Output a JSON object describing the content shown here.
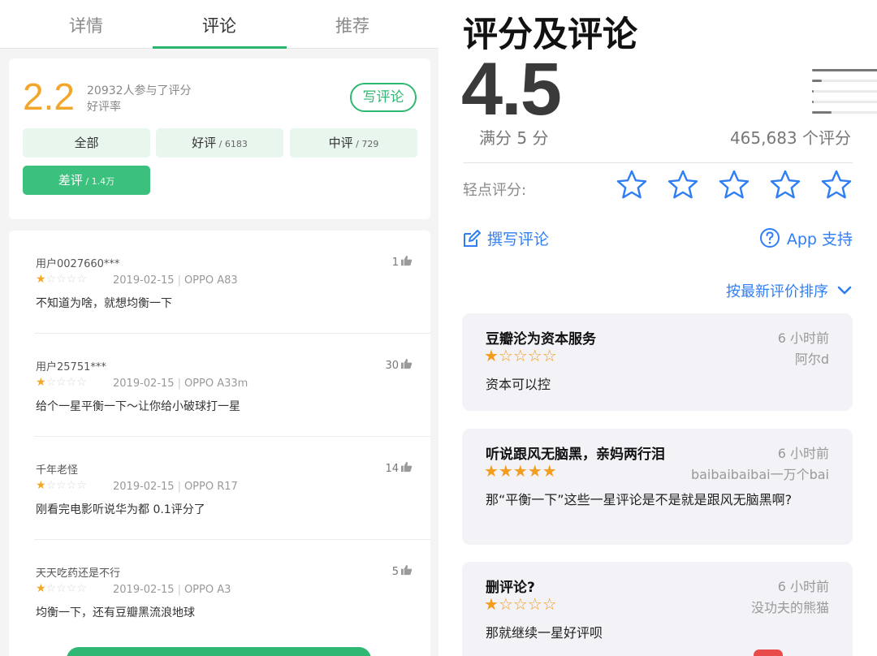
{
  "left": {
    "tabs": [
      "详情",
      "评论",
      "推荐"
    ],
    "summary": {
      "score": "2.2",
      "participants": "20932人参与了评分",
      "good_rate": "好评率",
      "write_button": "写评论",
      "filters": [
        {
          "label": "全部",
          "count": ""
        },
        {
          "label": "好评",
          "count": " / 6183"
        },
        {
          "label": "中评",
          "count": " / 729"
        },
        {
          "label": "差评",
          "count": " / 1.4万"
        }
      ]
    },
    "reviews": [
      {
        "user": "用户0027660***",
        "date": "2019-02-15",
        "device": "OPPO A83",
        "text": "不知道为啥，就想均衡一下",
        "likes": "1",
        "stars": 1
      },
      {
        "user": "用户25751***",
        "date": "2019-02-15",
        "device": "OPPO A33m",
        "text": "给个一星平衡一下～让你给小破球打一星",
        "likes": "30",
        "stars": 1
      },
      {
        "user": "千年老怪",
        "date": "2019-02-15",
        "device": "OPPO R17",
        "text": "刚看完电影听说华为都 0.1评分了",
        "likes": "14",
        "stars": 1
      },
      {
        "user": "天天吃药还是不行",
        "date": "2019-02-15",
        "device": "OPPO A3",
        "text": "均衡一下，还有豆瓣黑流浪地球",
        "likes": "5",
        "stars": 1
      }
    ]
  },
  "right": {
    "heading": "评分及评论",
    "score": "4.5",
    "out_of": "满分 5 分",
    "rating_count": "465,683 个评分",
    "histogram": [
      {
        "stars": "★★★★★",
        "fraction": 0.83
      },
      {
        "stars": "★★★★",
        "fraction": 0.05
      },
      {
        "stars": "★★★",
        "fraction": 0.01
      },
      {
        "stars": "★★",
        "fraction": 0.01
      },
      {
        "stars": "★",
        "fraction": 0.1
      }
    ],
    "tap_to_rate": "轻点评分:",
    "write_review": "撰写评论",
    "app_support": "App 支持",
    "sort_label": "按最新评价排序",
    "accent_color": "#2f7ef5",
    "reviews": [
      {
        "title": "豆瓣沦为资本服务",
        "time": "6 小时前",
        "author": "阿尔d",
        "stars": 1,
        "body": "资本可以控"
      },
      {
        "title": "听说跟风无脑黑，亲妈两行泪",
        "time": "6 小时前",
        "author": "baibaibaibai一万个bai",
        "stars": 5,
        "body": "那“平衡一下”这些一星评论是不是就是跟风无脑黑啊?"
      },
      {
        "title": "删评论?",
        "time": "6 小时前",
        "author": "没功夫的熊猫",
        "stars": 1,
        "body": "那就继续一星好评呗"
      }
    ]
  }
}
